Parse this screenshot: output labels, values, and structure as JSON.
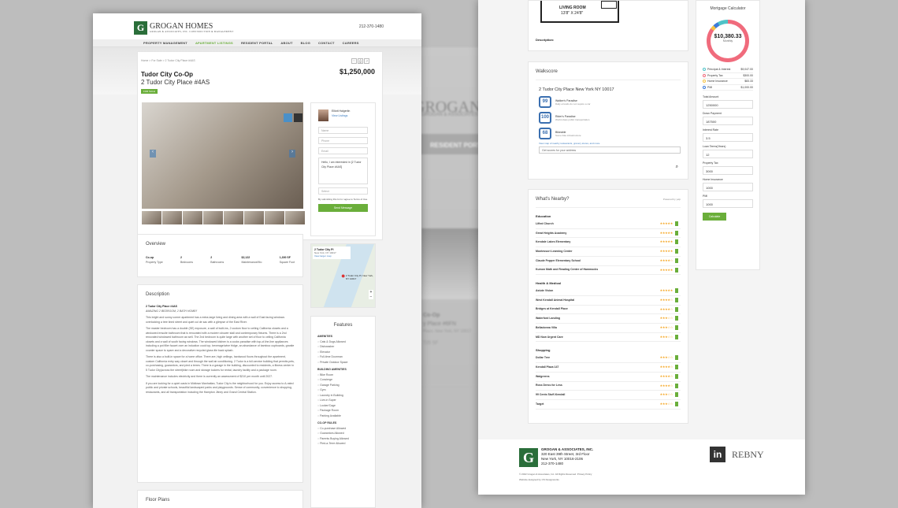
{
  "colors": {
    "accent": "#6aae3a",
    "brand_green": "#2a6e3a",
    "star": "#f5a623"
  },
  "brand": {
    "name": "GROGAN HOMES",
    "sub": "GROGAN & ASSOCIATES, INC. CONSTRUCTION & MANAGEMENT",
    "phone": "212-370-1480"
  },
  "nav": [
    "PROPERTY MANAGEMENT",
    "APARTMENT LISTINGS",
    "RESIDENT PORTAL",
    "ABOUT",
    "BLOG",
    "CONTACT",
    "CAREERS"
  ],
  "listing": {
    "breadcrumb": "Home  >  For Sale  >  2 Tudor City Place #4AS",
    "title": "Tudor City Co-Op",
    "address": "2 Tudor City Place #4AS",
    "price": "$1,250,000",
    "badge": "FOR SALE"
  },
  "agent": {
    "name": "Elliott Halgerlin",
    "link": "View Listings",
    "name_ph": "Name",
    "phone_ph": "Phone",
    "email_ph": "Email",
    "message": "Hello, I am interested in [2 Tudor City Place #4AS]",
    "select": "Select",
    "terms": "By submitting this form I agree to Terms of Use",
    "send": "Send Message"
  },
  "overview": {
    "heading": "Overview",
    "items": [
      {
        "v": "Co-op",
        "l": "Property Type"
      },
      {
        "v": "2",
        "l": "Bedrooms"
      },
      {
        "v": "2",
        "l": "Bathrooms"
      },
      {
        "v": "$2,122",
        "l": "Maintenance/Mo"
      },
      {
        "v": "1,300 SF",
        "l": "Square Foot"
      }
    ]
  },
  "map": {
    "label": "2 Tudor City Pl",
    "sub": "New York, NY 10017",
    "link": "View larger map",
    "pin": "2 Tudor City Pl, New York, NY 10017"
  },
  "description": {
    "heading": "Description",
    "title": "2 Tudor City Place #4AS",
    "tag": "AMAZING 2 BEDROOM, 2 BATH HOME!!",
    "p1": "This bright and sunny corner apartment has a extra-large living and dining area with a wall of East facing windows overlooking a tree lined street and quiet cul de sac with a glimpse of the East River.",
    "p2": "The master bedroom has a double (SE) exposure, a wall of built-ins, 2 custom floor to ceiling California closets and a windowed ensuite bathroom that is renovated with a modern shower stall and contemporary fixtures. There is a 2nd renovated windowed bathroom as well. The 2nd bedroom is quite large with another set of floor to ceiling California closets and a wall of south facing windows. The windowed kitchen is a cooks paradise with top-of-the-line appliances including a pot filler faucet over an induction cook top, beverage/wine fridge, an abundance of bamboo cupboards, granite counter space to spare and a decorative recycled glass tile back splash.",
    "p3": "There is also a built-in space for a home office. There are, high ceilings, hardwood floors throughout the apartment, custom California entry way closet and through the wall air conditioning. 2 Tudor is a full-service building that permits pets, co-purchasing, guarantors, and pied a terres. There is a garage in the building, discounted to residents, a fitness center in 5 Tudor City(across the street)bike room and storage lockers for rental, laundry facility and a package room.",
    "p4": "The maintenance includes electricity and there is currently an assessment of $210 per month until 2027.",
    "p5": "If you are looking for a quiet oasis in Midtown Manhattan, Tudor City is the neighborhood for you. Enjoy access to A-rated public and private schools, beautiful landscaped parks and playgrounds. Sense of community, convenience to shopping, restaurants, and all transportation including the Hampton Jitney and Grand Central Station."
  },
  "floorplans": {
    "heading": "Floor Plans"
  },
  "features": {
    "heading": "Features",
    "groups": [
      {
        "name": "AMENITIES",
        "items": [
          "Cats & Dogs Allowed",
          "Dishwasher",
          "Elevator",
          "Full-time Doorman",
          "Private Outdoor Space"
        ]
      },
      {
        "name": "BUILDING AMENITIES",
        "items": [
          "Bike Room",
          "Concierge",
          "Garage Parking",
          "Gym",
          "Laundry in Building",
          "Live-in Super",
          "Locker/Cage",
          "Package Room",
          "Parking Available"
        ]
      },
      {
        "name": "CO-OP RULES",
        "items": [
          "Co-purchase Allowed",
          "Guarantors Allowed",
          "Parents Buying Allowed",
          "Pied-a-Terre Allowed"
        ]
      }
    ]
  },
  "bg": {
    "logo": "GROGAN H",
    "sub": "GROGAN & ASSOCIATES",
    "portal": "RESIDENT PORTAL",
    "coop": "Co-Op",
    "addr": "y Place #6FN",
    "addr2": "Place, New York, NY 10017",
    "size": "725 SF"
  },
  "right": {
    "floorplan_label": "LIVING ROOM",
    "floorplan_dim": "13'8\" X 24'8\"",
    "description_label": "Description:",
    "walkscore": {
      "heading": "Walkscore",
      "address": "2 Tudor City Place New York NY 10017",
      "scores": [
        {
          "n": "99",
          "t": "Walker's Paradise",
          "d": "Daily errands do not require a car"
        },
        {
          "n": "100",
          "t": "Rider's Paradise",
          "d": "World-class public transportation"
        },
        {
          "n": "68",
          "t": "Bikeable",
          "d": "Some bike infrastructure"
        }
      ],
      "link": "View map of nearby restaurants, grocery stores, and more.",
      "input_ph": "Get scores for your address"
    },
    "nearby": {
      "heading": "What's Nearby?",
      "powered": "Powered by yelp",
      "groups": [
        {
          "name": "Education",
          "items": [
            "Lifted Church",
            "Great Heights Academy",
            "Kendale Lakes Elementary",
            "Montessori Learning Center",
            "Claude Pepper Elementary School",
            "Kumon Math and Reading Center of Hammocks"
          ]
        },
        {
          "name": "Health & Medical",
          "items": [
            "Astute Vision",
            "West Kendall Animal Hospital",
            "Bridges at Kendall Place",
            "Waterford Landing",
            "Belladonna Villa",
            "MD Now Urgent Care"
          ]
        },
        {
          "name": "Shopping",
          "items": [
            "Dollar Tree",
            "Kendall Plaza 147",
            "Walgreens",
            "Ross Dress for Less",
            "99 Cents Stuff-Kendall",
            "Target"
          ]
        }
      ]
    },
    "mortgage": {
      "heading": "Mortgage Calculator",
      "amount": "$10,380.33",
      "period": "Monthly",
      "legend": [
        {
          "n": "Principal & Interest",
          "v": "$9,047.00",
          "c": "#4fc3c8"
        },
        {
          "n": "Property Tax",
          "v": "$300.00",
          "c": "#f06b7c"
        },
        {
          "n": "Home Insurance",
          "v": "$83.33",
          "c": "#f5c243"
        },
        {
          "n": "PMI",
          "v": "$1,000.00",
          "c": "#3d7bd9"
        }
      ],
      "fields": [
        {
          "l": "Total Amount",
          "v": "1250000"
        },
        {
          "l": "Down Payment",
          "v": "187500"
        },
        {
          "l": "Interest Rate",
          "v": "3.5"
        },
        {
          "l": "Loan Terms(Years)",
          "v": "12"
        },
        {
          "l": "Property Tax",
          "v": "3000"
        },
        {
          "l": "Home Insurance",
          "v": "1000"
        },
        {
          "l": "PMI",
          "v": "1000"
        }
      ],
      "button": "Calculate"
    },
    "footer": {
      "company": "GROGAN & ASSOCIATES, INC.",
      "addr1": "320 East 39th Street, 3rd Floor",
      "addr2": "New York, NY 10016-2106",
      "phone": "212-370-1480",
      "copy": "© 2022 Grogan & Associates, Inc. All Rights Reserved. Privacy Policy",
      "designed": "Website designed by CS Designworks",
      "in": "in",
      "rebny": "REBNY"
    }
  }
}
